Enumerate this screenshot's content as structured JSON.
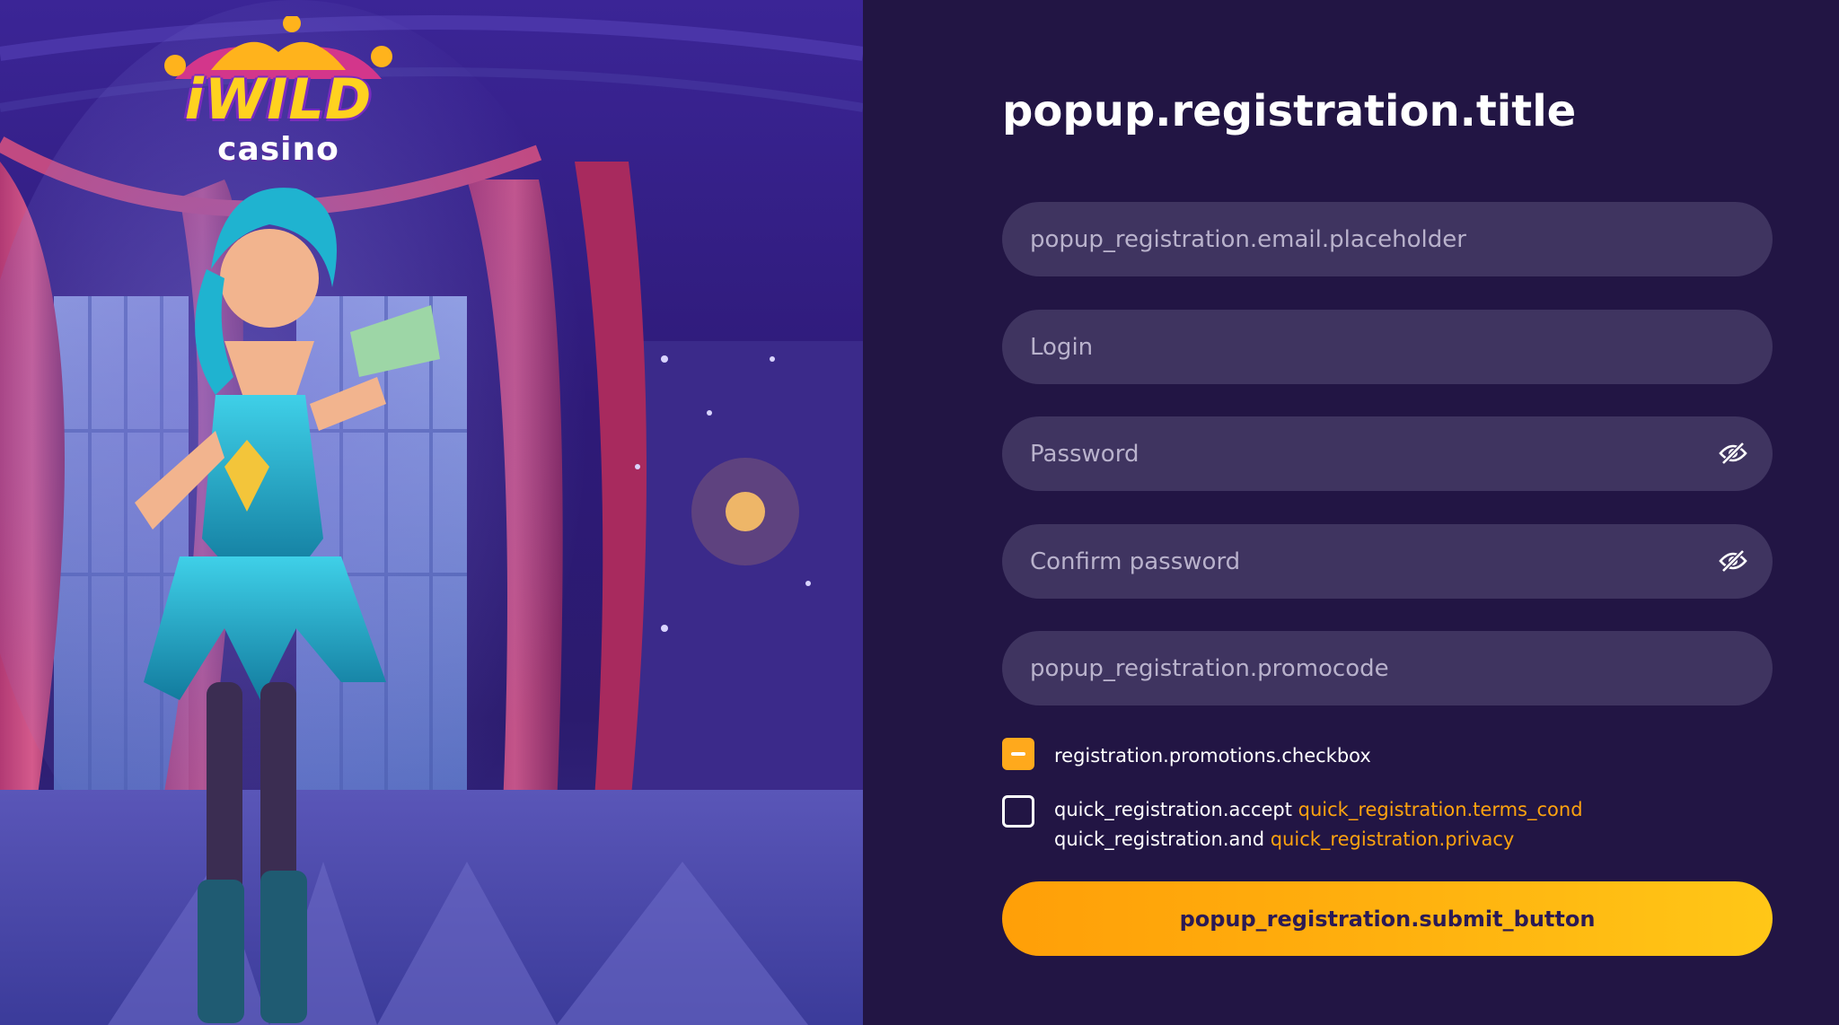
{
  "logo": {
    "brand": "iWILD",
    "sub": "casino"
  },
  "form": {
    "title": "popup.registration.title",
    "email_placeholder": "popup_registration.email.placeholder",
    "login_placeholder": "Login",
    "password_placeholder": "Password",
    "confirm_password_placeholder": "Confirm password",
    "promocode_placeholder": "popup_registration.promocode",
    "password_visibility_icon": "eye-off-icon",
    "promotions": {
      "label": "registration.promotions.checkbox",
      "checked": true
    },
    "terms": {
      "accept_text": "quick_registration.accept",
      "terms_link": "quick_registration.terms_cond",
      "and_text": "quick_registration.and",
      "privacy_link": "quick_registration.privacy",
      "checked": false
    },
    "submit_label": "popup_registration.submit_button"
  },
  "colors": {
    "background": "#221544",
    "field": "#3f3460",
    "accent": "#ffa91c",
    "link": "#ffa30f"
  }
}
